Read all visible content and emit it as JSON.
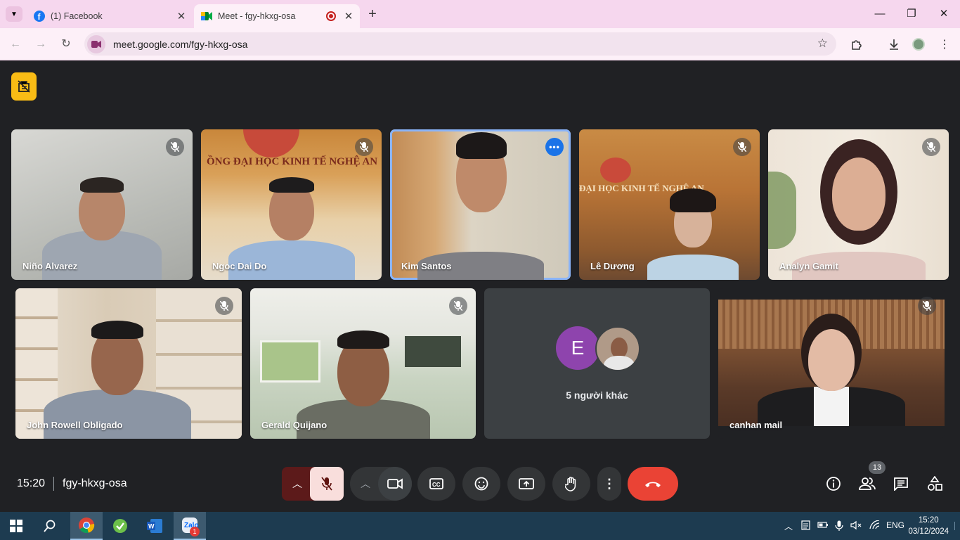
{
  "browser": {
    "tabs": [
      {
        "title": "(1) Facebook",
        "icon": "facebook-icon"
      },
      {
        "title": "Meet - fgy-hkxg-osa",
        "icon": "google-meet-icon",
        "recording": true
      }
    ],
    "url": "meet.google.com/fgy-hkxg-osa"
  },
  "participants": [
    {
      "name": "Niño Alvarez",
      "muted": true
    },
    {
      "name": "Ngoc Dai Do",
      "muted": true
    },
    {
      "name": "Kim Santos",
      "muted": false,
      "active": true
    },
    {
      "name": "Lê Dương",
      "muted": true
    },
    {
      "name": "Analyn Gamit",
      "muted": true
    },
    {
      "name": "John Rowell Obligado",
      "muted": true
    },
    {
      "name": "Gerald Quijano",
      "muted": true
    },
    {
      "name": "canhan mail",
      "muted": true
    }
  ],
  "others": {
    "avatar_letter": "E",
    "label": "5 người khác"
  },
  "meeting": {
    "time": "15:20",
    "code": "fgy-hkxg-osa",
    "people_count": "13"
  },
  "taskbar": {
    "language": "ENG",
    "time": "15:20",
    "date": "03/12/2024",
    "zalo_badge": "1"
  },
  "colors": {
    "accent": "#1a73e8",
    "end_call": "#ea4335",
    "overlay_button": "#f9bc15"
  }
}
